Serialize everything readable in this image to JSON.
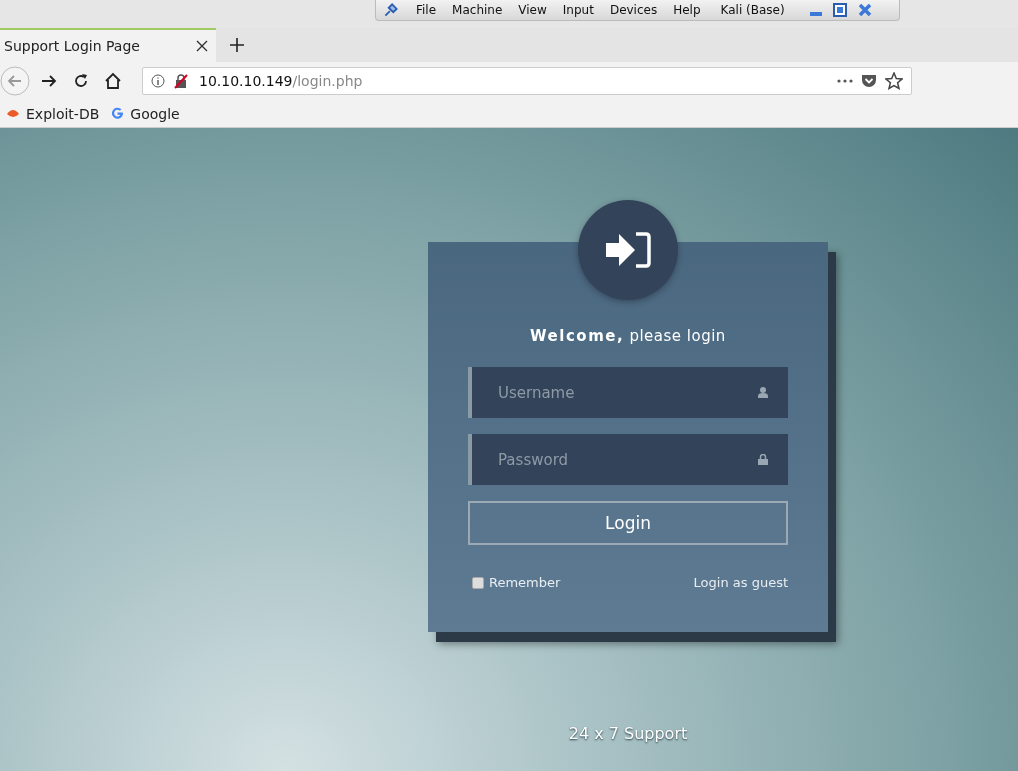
{
  "vm_menu": {
    "items": [
      "File",
      "Machine",
      "View",
      "Input",
      "Devices",
      "Help"
    ],
    "machine_name": "Kali (Base)"
  },
  "browser": {
    "tab": {
      "title": "Support Login Page",
      "selected": true
    },
    "url": {
      "host": "10.10.10.149",
      "path": "/login.php"
    },
    "bookmarks": [
      "Exploit-DB",
      "Google"
    ]
  },
  "login": {
    "greeting": "**Welcome,** please login",
    "username_placeholder": "Username",
    "password_placeholder": "Password",
    "button": "Login",
    "remember": {
      "label": "Remember",
      "checked": false
    },
    "guest_link": "Login as guest"
  },
  "footer": "24 x 7 Support"
}
